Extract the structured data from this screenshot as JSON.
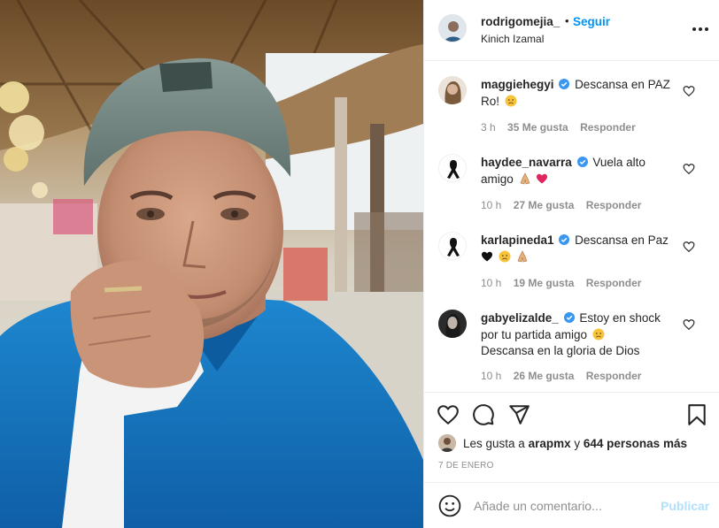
{
  "header": {
    "username": "rodrigomejia_",
    "separator": "•",
    "follow_label": "Seguir",
    "location": "Kinich Izamal"
  },
  "comments": [
    {
      "username": "maggiehegyi",
      "verified": true,
      "text": "Descansa en PAZ Ro!",
      "emoji": "sad-face",
      "time": "3 h",
      "likes": "35 Me gusta",
      "reply": "Responder"
    },
    {
      "username": "haydee_navarra",
      "verified": true,
      "text": "Vuela alto amigo",
      "emoji": "praying-hands, red-heart",
      "time": "10 h",
      "likes": "27 Me gusta",
      "reply": "Responder"
    },
    {
      "username": "karlapineda1",
      "verified": true,
      "text": "Descansa en Paz",
      "emoji": "black-heart, sad-face, praying-hands",
      "time": "10 h",
      "likes": "19 Me gusta",
      "reply": "Responder"
    },
    {
      "username": "gabyelizalde_",
      "verified": true,
      "text": "Estoy en shock por tu partida amigo",
      "text_2": "Descansa en la gloria de Dios",
      "emoji": "sad-face",
      "time": "10 h",
      "likes": "26 Me gusta",
      "reply": "Responder"
    }
  ],
  "likes": {
    "prefix": "Les gusta a",
    "user": "arapmx",
    "joiner": "y",
    "others": "644 personas más"
  },
  "date": "7 DE ENERO",
  "comment_box": {
    "placeholder": "Añade un comentario...",
    "publish_label": "Publicar"
  },
  "colors": {
    "accent": "#0095f6",
    "publish_disabled": "#b2dffc",
    "muted": "#8e8e8e",
    "text": "#262626",
    "border": "#efefef"
  },
  "icons": [
    "more-options-icon",
    "verified-badge-icon",
    "heart-outline-icon",
    "comment-icon",
    "share-icon",
    "bookmark-icon",
    "smiley-icon"
  ]
}
